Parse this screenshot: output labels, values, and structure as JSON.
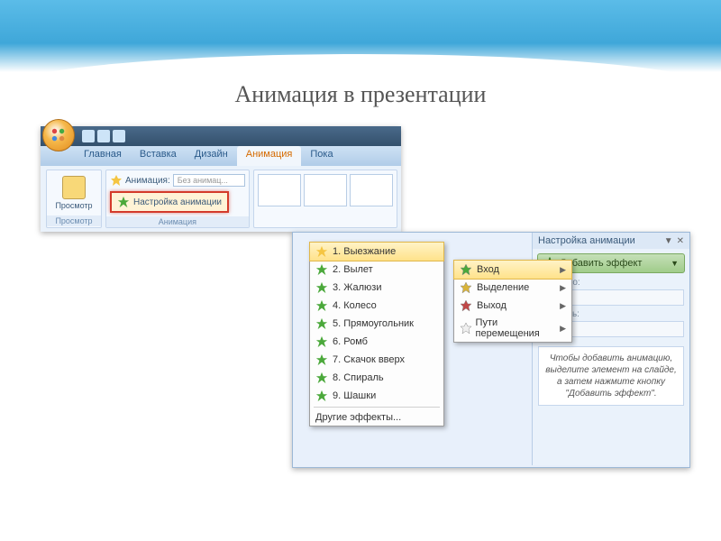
{
  "slide_title": "Анимация в презентации",
  "ribbon": {
    "tabs": [
      "Главная",
      "Вставка",
      "Дизайн",
      "Анимация",
      "Пока"
    ],
    "active_tab_index": 3,
    "preview_label": "Просмотр",
    "preview_group_label": "Просмотр",
    "anim_label": "Анимация:",
    "anim_value": "Без анимац...",
    "custom_anim_label": "Настройка анимации",
    "anim_group_label": "Анимация"
  },
  "effects_menu": {
    "items": [
      "1. Выезжание",
      "2. Вылет",
      "3. Жалюзи",
      "4. Колесо",
      "5. Прямоугольник",
      "6. Ромб",
      "7. Скачок вверх",
      "8. Спираль",
      "9. Шашки"
    ],
    "other": "Другие эффекты..."
  },
  "category_menu": {
    "items": [
      "Вход",
      "Выделение",
      "Выход",
      "Пути перемещения"
    ],
    "colors": [
      "#4aa83a",
      "#d9b43a",
      "#c04848",
      "#f0f0f0"
    ]
  },
  "task_pane": {
    "title": "Настройка анимации",
    "add_effect": "Добавить эффект",
    "field1": "Свойство:",
    "field2": "Скорость:",
    "hint": "Чтобы добавить анимацию, выделите элемент на слайде, а затем нажмите кнопку \"Добавить эффект\"."
  }
}
